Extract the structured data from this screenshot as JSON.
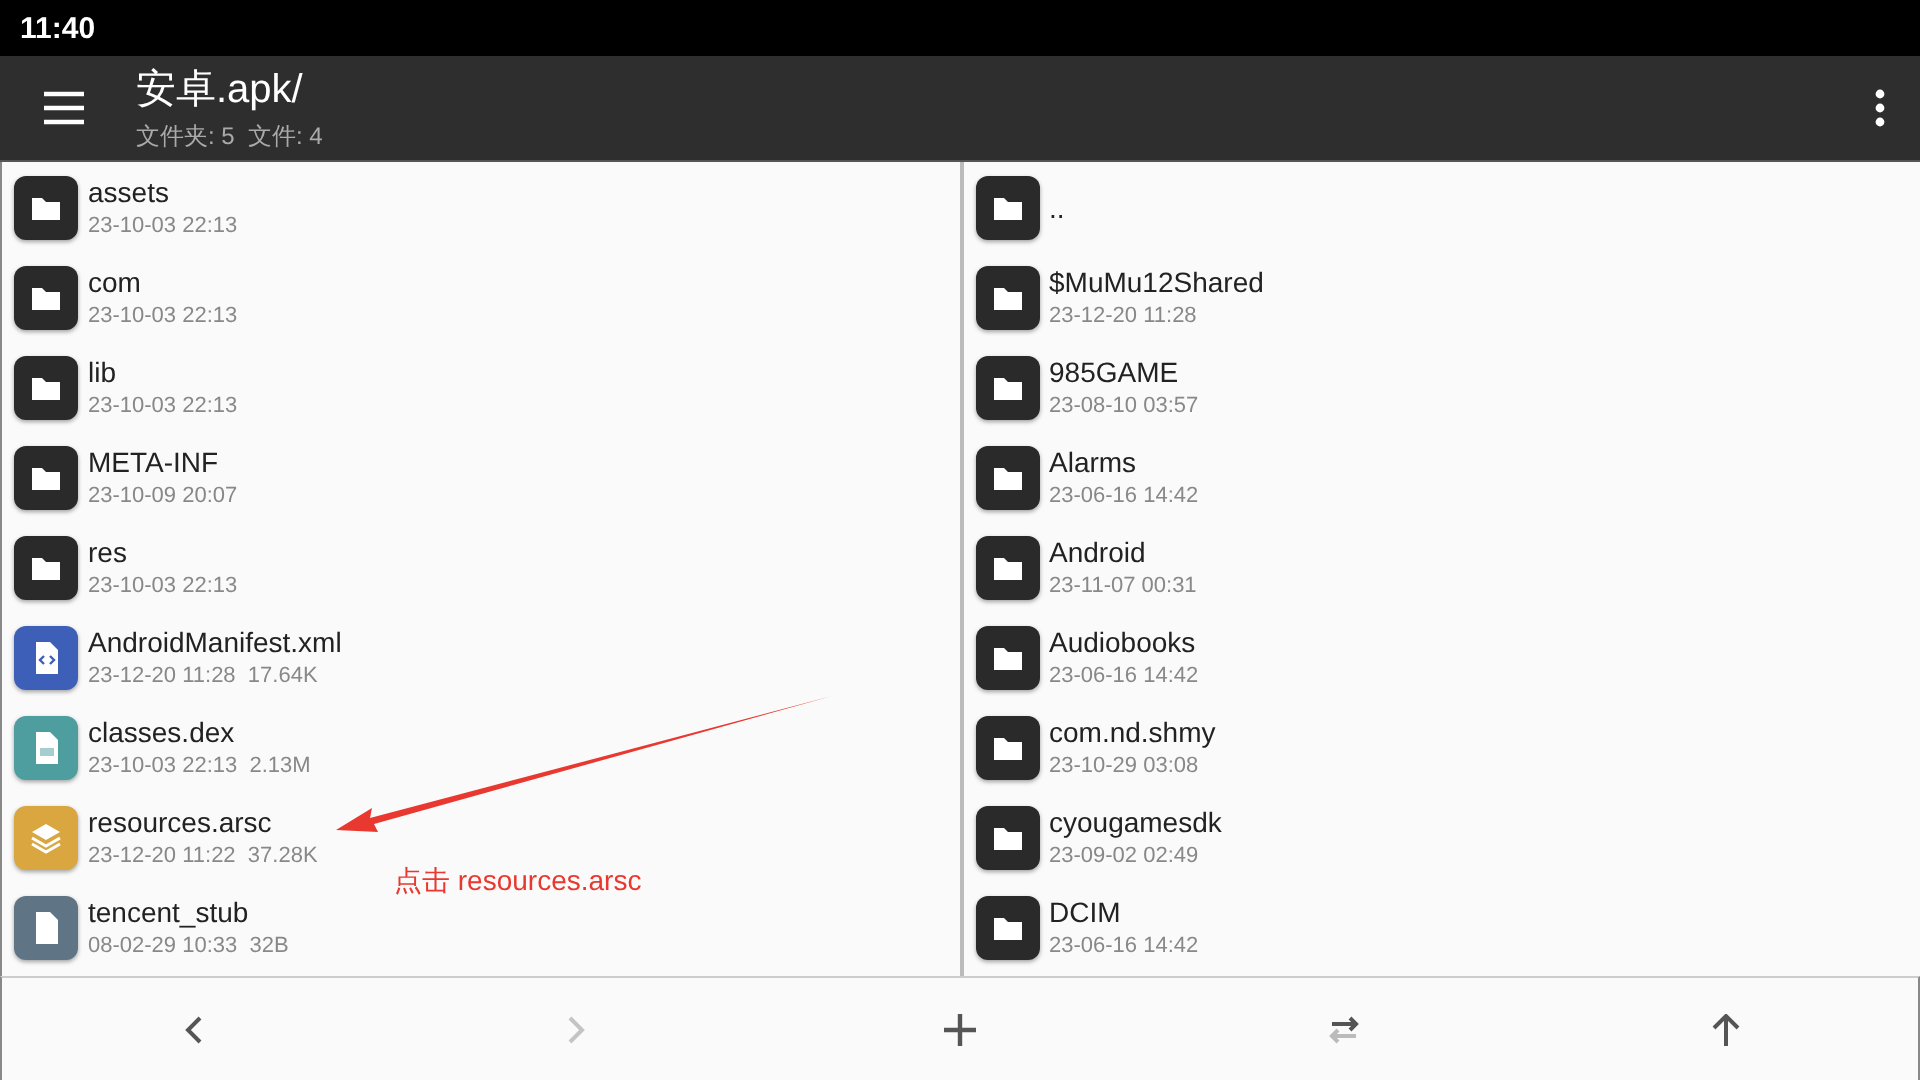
{
  "status_bar": {
    "time": "11:40"
  },
  "toolbar": {
    "title": "安卓.apk/",
    "subtitle": "文件夹: 5  文件: 4"
  },
  "left_panel": {
    "items": [
      {
        "kind": "folder",
        "name": "assets",
        "info": "23-10-03 22:13"
      },
      {
        "kind": "folder",
        "name": "com",
        "info": "23-10-03 22:13"
      },
      {
        "kind": "folder",
        "name": "lib",
        "info": "23-10-03 22:13"
      },
      {
        "kind": "folder",
        "name": "META-INF",
        "info": "23-10-09 20:07"
      },
      {
        "kind": "folder",
        "name": "res",
        "info": "23-10-03 22:13"
      },
      {
        "kind": "xml",
        "name": "AndroidManifest.xml",
        "info": "23-12-20 11:28  17.64K"
      },
      {
        "kind": "dex",
        "name": "classes.dex",
        "info": "23-10-03 22:13  2.13M"
      },
      {
        "kind": "arsc",
        "name": "resources.arsc",
        "info": "23-12-20 11:22  37.28K"
      },
      {
        "kind": "file",
        "name": "tencent_stub",
        "info": "08-02-29 10:33  32B"
      }
    ]
  },
  "right_panel": {
    "items": [
      {
        "kind": "folder",
        "name": ".."
      },
      {
        "kind": "folder",
        "name": "$MuMu12Shared",
        "info": "23-12-20 11:28"
      },
      {
        "kind": "folder",
        "name": "985GAME",
        "info": "23-08-10 03:57"
      },
      {
        "kind": "folder",
        "name": "Alarms",
        "info": "23-06-16 14:42"
      },
      {
        "kind": "folder",
        "name": "Android",
        "info": "23-11-07 00:31"
      },
      {
        "kind": "folder",
        "name": "Audiobooks",
        "info": "23-06-16 14:42"
      },
      {
        "kind": "folder",
        "name": "com.nd.shmy",
        "info": "23-10-29 03:08"
      },
      {
        "kind": "folder",
        "name": "cyougamesdk",
        "info": "23-09-02 02:49"
      },
      {
        "kind": "folder",
        "name": "DCIM",
        "info": "23-06-16 14:42"
      }
    ]
  },
  "annotation": {
    "text": "点击 resources.arsc"
  },
  "bottom_bar": [
    {
      "kind": "back",
      "disabled": false
    },
    {
      "kind": "forward",
      "disabled": true
    },
    {
      "kind": "add",
      "disabled": false
    },
    {
      "kind": "swap",
      "disabled": false
    },
    {
      "kind": "up",
      "disabled": false
    }
  ]
}
